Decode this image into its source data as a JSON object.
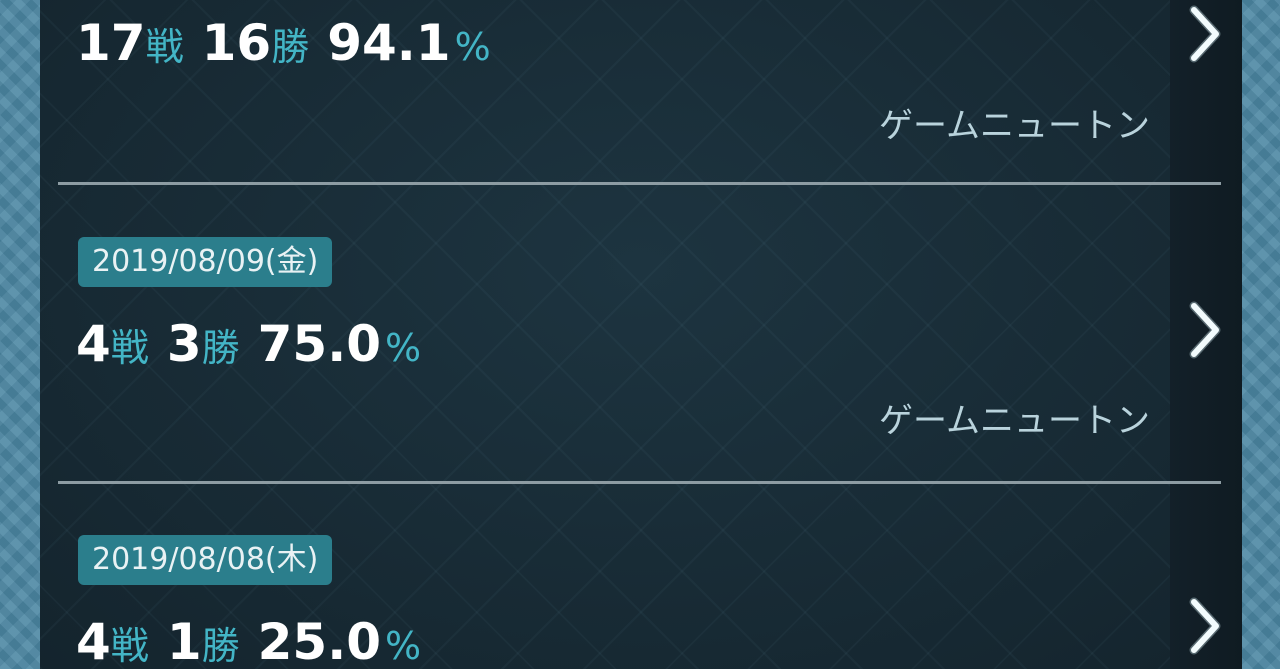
{
  "records": [
    {
      "date": "",
      "battles": "17",
      "battles_unit": "戦",
      "wins": "16",
      "wins_unit": "勝",
      "rate": "94.1",
      "rate_unit": "%",
      "shop": "ゲームニュートン"
    },
    {
      "date": "2019/08/09(金)",
      "battles": "4",
      "battles_unit": "戦",
      "wins": "3",
      "wins_unit": "勝",
      "rate": "75.0",
      "rate_unit": "%",
      "shop": "ゲームニュートン"
    },
    {
      "date": "2019/08/08(木)",
      "battles": "4",
      "battles_unit": "戦",
      "wins": "1",
      "wins_unit": "勝",
      "rate": "25.0",
      "rate_unit": "%",
      "shop": ""
    }
  ],
  "icons": {
    "chevron": "chevron-right-icon"
  },
  "colors": {
    "accent": "#43b5c6",
    "badge": "#2b7e8c",
    "panel": "#182b36",
    "frame": "#4c87a3"
  }
}
